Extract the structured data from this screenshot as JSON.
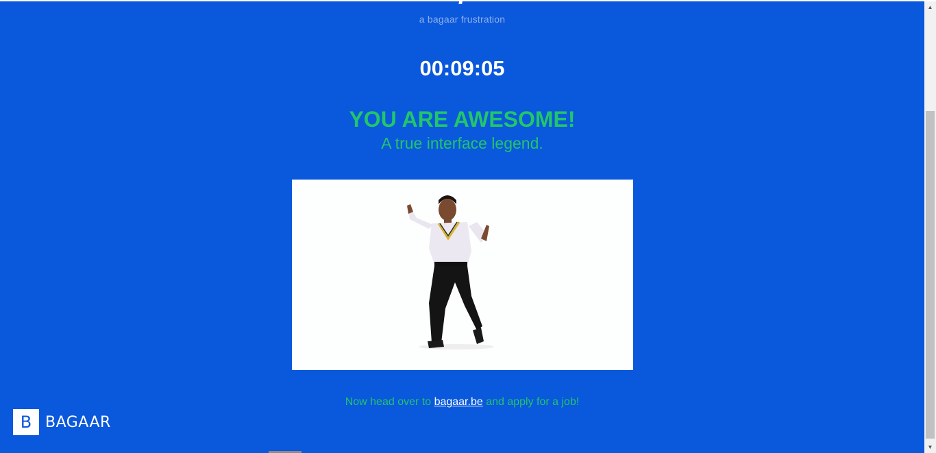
{
  "header": {
    "title_fragment": "/",
    "subtitle": "a bagaar frustration"
  },
  "timer": {
    "value": "00:09:05"
  },
  "result": {
    "headline": "YOU ARE AWESOME!",
    "tagline": "A true interface legend."
  },
  "cta": {
    "prefix": "Now head over to ",
    "link_text": "bagaar.be",
    "suffix": " and apply for a job!"
  },
  "logo": {
    "letter": "B",
    "name": "BAGAAR"
  },
  "colors": {
    "background": "#0a58dc",
    "accent_green": "#22c66a",
    "white": "#ffffff"
  },
  "icons": {
    "scroll_up": "scroll-up-arrow-icon",
    "scroll_down": "scroll-down-arrow-icon"
  }
}
